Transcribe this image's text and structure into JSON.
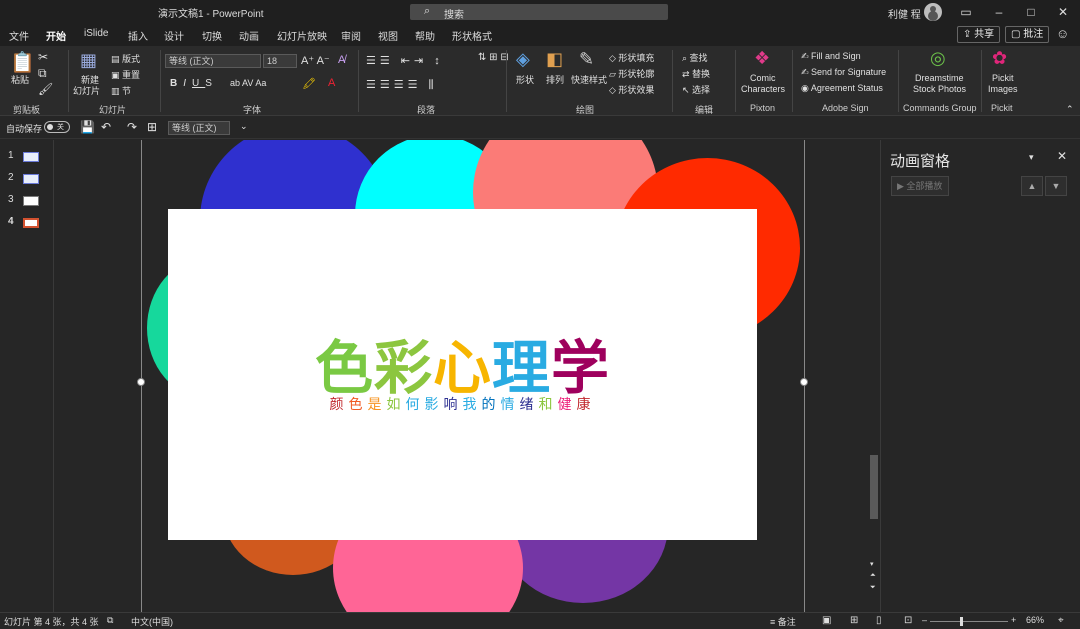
{
  "titlebar": {
    "doc_title": "演示文稿1  -  PowerPoint",
    "search_placeholder": "搜索",
    "user": "利健 程"
  },
  "tabs": [
    "文件",
    "开始",
    "iSlide",
    "插入",
    "设计",
    "切换",
    "动画",
    "幻灯片放映",
    "审阅",
    "视图",
    "帮助",
    "形状格式"
  ],
  "active_tab": "开始",
  "actions": {
    "share": "共享",
    "comment": "批注"
  },
  "ribbon": {
    "clipboard": {
      "paste": "粘贴",
      "label": "剪贴板"
    },
    "slides": {
      "new_slide_1": "新建",
      "new_slide_2": "幻灯片",
      "layout": "版式",
      "reset": "重置",
      "section": "节",
      "label": "幻灯片"
    },
    "font": {
      "font_name": "等线 (正文)",
      "font_size": "18",
      "label": "字体"
    },
    "paragraph": {
      "label": "段落"
    },
    "drawing": {
      "shapes": "形状",
      "arrange": "排列",
      "quick_styles": "快速样式",
      "shape_fill": "形状填充",
      "shape_outline": "形状轮廓",
      "shape_effects": "形状效果",
      "label": "绘图"
    },
    "editing": {
      "find": "查找",
      "replace": "替换",
      "select": "选择",
      "label": "编辑"
    },
    "pixton": {
      "line1": "Comic",
      "line2": "Characters",
      "label": "Pixton"
    },
    "adobe": {
      "fill_sign": "Fill and Sign",
      "send_sig": "Send for Signature",
      "agreement": "Agreement Status",
      "label": "Adobe Sign"
    },
    "dreamstime": {
      "line1": "Dreamstime",
      "line2": "Stock Photos",
      "label": "Commands Group"
    },
    "pickit": {
      "line1": "Pickit",
      "line2": "Images",
      "label": "Pickit"
    }
  },
  "qat": {
    "autosave": "自动保存",
    "toggle_state": "关",
    "font": "等线 (正文)"
  },
  "thumbnails": [
    "1",
    "2",
    "3",
    "4"
  ],
  "slide": {
    "title_chars": [
      "色",
      "彩",
      "心",
      "理",
      "学"
    ],
    "subtitle_chars": [
      "颜",
      "色",
      "是",
      "如",
      "何",
      "影",
      "响",
      "我",
      "的",
      "情",
      "绪",
      "和",
      "健",
      "康"
    ]
  },
  "colors": {
    "title": [
      "#7ac943",
      "#7ac943",
      "#f7b500",
      "#29abe2",
      "#9e005d"
    ],
    "subtitle": [
      "#c1272d",
      "#f15a24",
      "#f7931e",
      "#8cc63f",
      "#29abe2",
      "#29abe2",
      "#2e3192",
      "#29abe2",
      "#0071bc",
      "#29abe2",
      "#2e3192",
      "#8cc63f",
      "#ed1e79",
      "#c1272d"
    ],
    "accent": "#d35230"
  },
  "animation_pane": {
    "title": "动画窗格",
    "play_all": "全部播放"
  },
  "status": {
    "slide_info": "幻灯片 第 4 张，共 4 张",
    "language": "中文(中国)",
    "notes": "备注",
    "zoom": "66%"
  }
}
